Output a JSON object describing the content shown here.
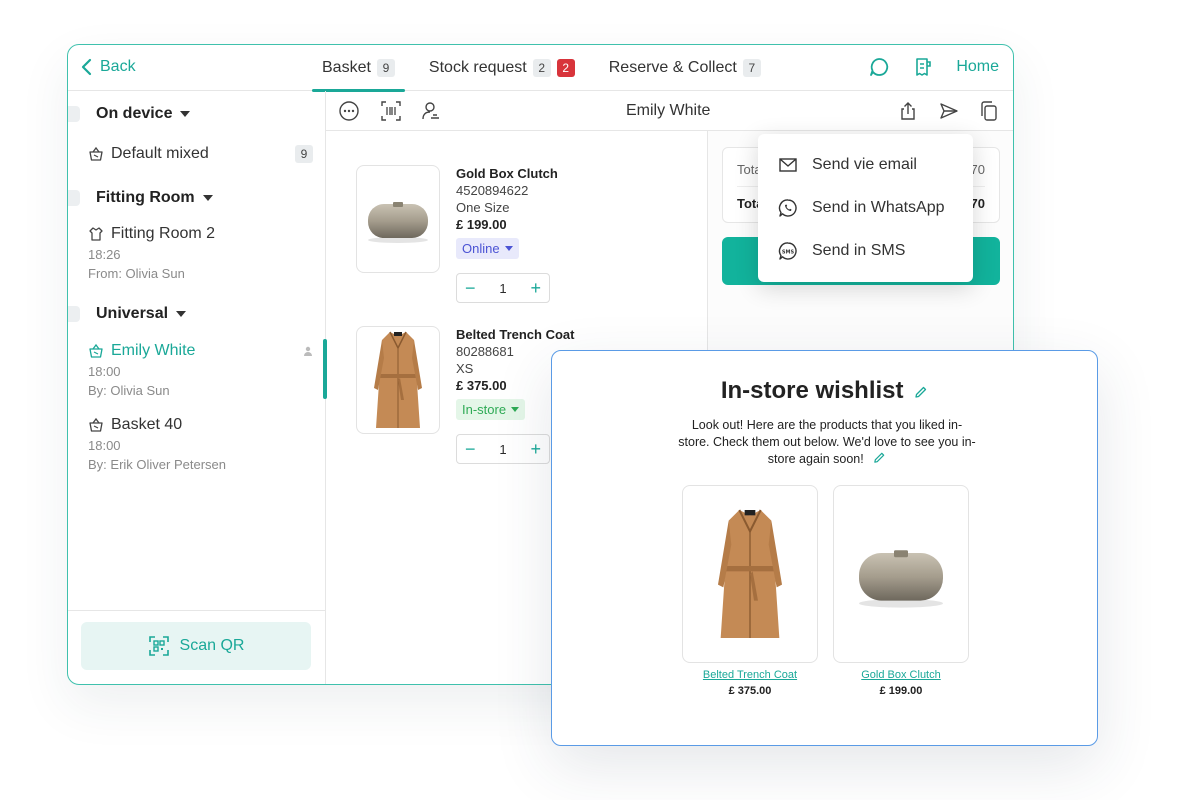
{
  "topbar": {
    "back_label": "Back",
    "tabs": [
      {
        "label": "Basket",
        "count": "9"
      },
      {
        "label": "Stock request",
        "count": "2",
        "alert": "2"
      },
      {
        "label": "Reserve & Collect",
        "count": "7"
      }
    ],
    "home_label": "Home"
  },
  "sidebar": {
    "groups": [
      {
        "title": "On device",
        "items": [
          {
            "name": "Default mixed",
            "count": "9"
          }
        ]
      },
      {
        "title": "Fitting Room",
        "items": [
          {
            "name": "Fitting Room 2",
            "time": "18:26",
            "by": "From: Olivia Sun"
          }
        ]
      },
      {
        "title": "Universal",
        "items": [
          {
            "name": "Emily White",
            "time": "18:00",
            "by": "By: Olivia Sun"
          },
          {
            "name": "Basket 40",
            "time": "18:00",
            "by": "By: Erik Oliver Petersen"
          }
        ]
      }
    ],
    "scan_label": "Scan QR"
  },
  "main": {
    "customer_name": "Emily White",
    "products": [
      {
        "name": "Gold Box Clutch",
        "sku": "4520894622",
        "size": "One Size",
        "price": "£ 199.00",
        "channel": "Online",
        "qty": "1"
      },
      {
        "name": "Belted Trench Coat",
        "sku": "80288681",
        "size": "XS",
        "price": "£ 375.00",
        "channel": "In-store",
        "qty": "1"
      }
    ],
    "summary": {
      "row1_label": "Tota",
      "row1_value": "70",
      "row2_label": "Tota",
      "row2_value": "70"
    }
  },
  "share_menu": {
    "items": [
      {
        "label": "Send vie email",
        "icon": "mail-icon"
      },
      {
        "label": "Send in WhatsApp",
        "icon": "whatsapp-icon"
      },
      {
        "label": "Send in SMS",
        "icon": "sms-icon"
      }
    ]
  },
  "wishlist": {
    "title": "In-store wishlist",
    "message": "Look out! Here are the products that you liked in-store. Check them out below. We'd love to see you in-store again soon!",
    "products": [
      {
        "name": "Belted Trench Coat",
        "price": "£ 375.00"
      },
      {
        "name": "Gold Box Clutch",
        "price": "£ 199.00"
      }
    ]
  },
  "colors": {
    "accent": "#1aa898",
    "checkout": "#12b39c",
    "alert": "#d8343b",
    "wishlist_border": "#5a9be6"
  }
}
